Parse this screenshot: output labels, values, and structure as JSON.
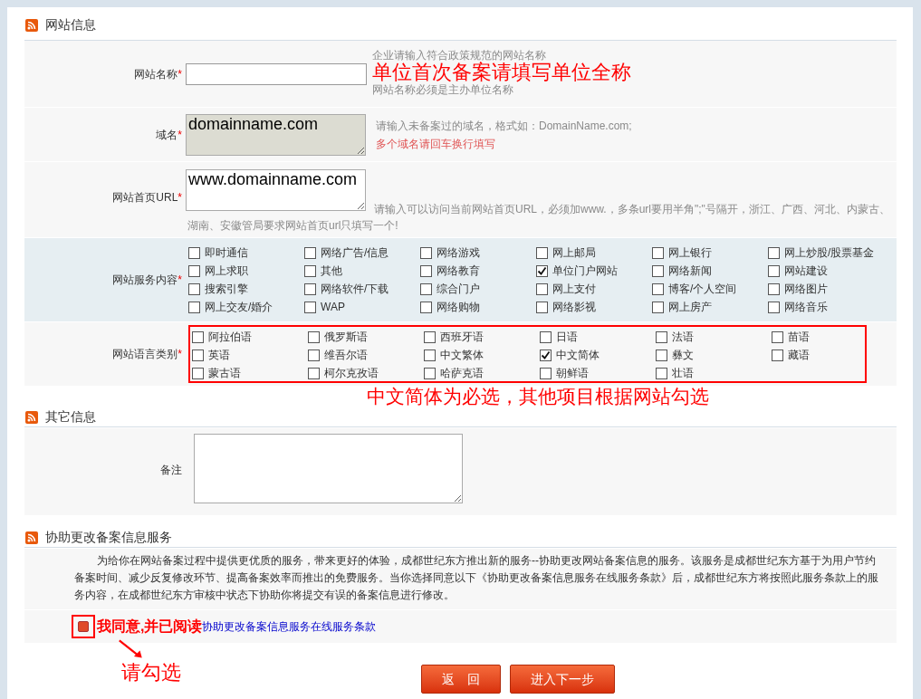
{
  "site_info": {
    "title": "网站信息",
    "name_field": {
      "label": "网站名称",
      "required": "*",
      "hint_top": "企业请输入符合政策规范的网站名称",
      "annotation": "单位首次备案请填写单位全称",
      "hint_bottom": "网站名称必须是主办单位名称"
    },
    "domain_field": {
      "label": "域名",
      "required": "*",
      "value": "domainname.com",
      "hint": "请输入未备案过的域名，格式如：DomainName.com;",
      "hint_red": "多个域名请回车换行填写"
    },
    "url_field": {
      "label": "网站首页URL",
      "required": "*",
      "value": "www.domainname.com",
      "hint": "请输入可以访问当前网站首页URL，必须加www.，多条url要用半角\";\"号隔开，浙江、广西、河北、内蒙古、湖南、安徽管局要求网站首页url只填写一个!"
    },
    "services": {
      "label": "网站服务内容",
      "required": "*",
      "options": [
        {
          "label": "即时通信",
          "checked": false
        },
        {
          "label": "网络广告/信息",
          "checked": false
        },
        {
          "label": "网络游戏",
          "checked": false
        },
        {
          "label": "网上邮局",
          "checked": false
        },
        {
          "label": "网上银行",
          "checked": false
        },
        {
          "label": "网上炒股/股票基金",
          "checked": false
        },
        {
          "label": "网上求职",
          "checked": false
        },
        {
          "label": "其他",
          "checked": false
        },
        {
          "label": "网络教育",
          "checked": false
        },
        {
          "label": "单位门户网站",
          "checked": true
        },
        {
          "label": "网络新闻",
          "checked": false
        },
        {
          "label": "网站建设",
          "checked": false
        },
        {
          "label": "搜索引擎",
          "checked": false
        },
        {
          "label": "网络软件/下载",
          "checked": false
        },
        {
          "label": "综合门户",
          "checked": false
        },
        {
          "label": "网上支付",
          "checked": false
        },
        {
          "label": "博客/个人空间",
          "checked": false
        },
        {
          "label": "网络图片",
          "checked": false
        },
        {
          "label": "网上交友/婚介",
          "checked": false
        },
        {
          "label": "WAP",
          "checked": false
        },
        {
          "label": "网络购物",
          "checked": false
        },
        {
          "label": "网络影视",
          "checked": false
        },
        {
          "label": "网上房产",
          "checked": false
        },
        {
          "label": "网络音乐",
          "checked": false
        }
      ]
    },
    "languages": {
      "label": "网站语言类别",
      "required": "*",
      "options": [
        {
          "label": "阿拉伯语",
          "checked": false
        },
        {
          "label": "俄罗斯语",
          "checked": false
        },
        {
          "label": "西班牙语",
          "checked": false
        },
        {
          "label": "日语",
          "checked": false
        },
        {
          "label": "法语",
          "checked": false
        },
        {
          "label": "苗语",
          "checked": false
        },
        {
          "label": "英语",
          "checked": false
        },
        {
          "label": "维吾尔语",
          "checked": false
        },
        {
          "label": "中文繁体",
          "checked": false
        },
        {
          "label": "中文简体",
          "checked": true
        },
        {
          "label": "彝文",
          "checked": false
        },
        {
          "label": "藏语",
          "checked": false
        },
        {
          "label": "蒙古语",
          "checked": false
        },
        {
          "label": "柯尔克孜语",
          "checked": false
        },
        {
          "label": "哈萨克语",
          "checked": false
        },
        {
          "label": "朝鲜语",
          "checked": false
        },
        {
          "label": "壮语",
          "checked": false
        }
      ],
      "annotation": "中文简体为必选，其他项目根据网站勾选"
    }
  },
  "other_info": {
    "title": "其它信息",
    "remark": {
      "label": "备注"
    }
  },
  "assist_service": {
    "title": "协助更改备案信息服务",
    "description": "为给你在网站备案过程中提供更优质的服务，带来更好的体验，成都世纪东方推出新的服务--协助更改网站备案信息的服务。该服务是成都世纪东方基于为用户节约备案时间、减少反复修改环节、提高备案效率而推出的免费服务。当你选择同意以下《协助更改备案信息服务在线服务条款》后，成都世纪东方将按照此服务条款上的服务内容，在成都世纪东方审核中状态下协助你将提交有误的备案信息进行修改。",
    "agree": {
      "checked": false,
      "label": "我同意,并已阅读",
      "link": "协助更改备案信息服务在线服务条款"
    },
    "annotation": "请勾选"
  },
  "buttons": [
    {
      "label": "返　回"
    },
    {
      "label": "进入下一步"
    }
  ]
}
